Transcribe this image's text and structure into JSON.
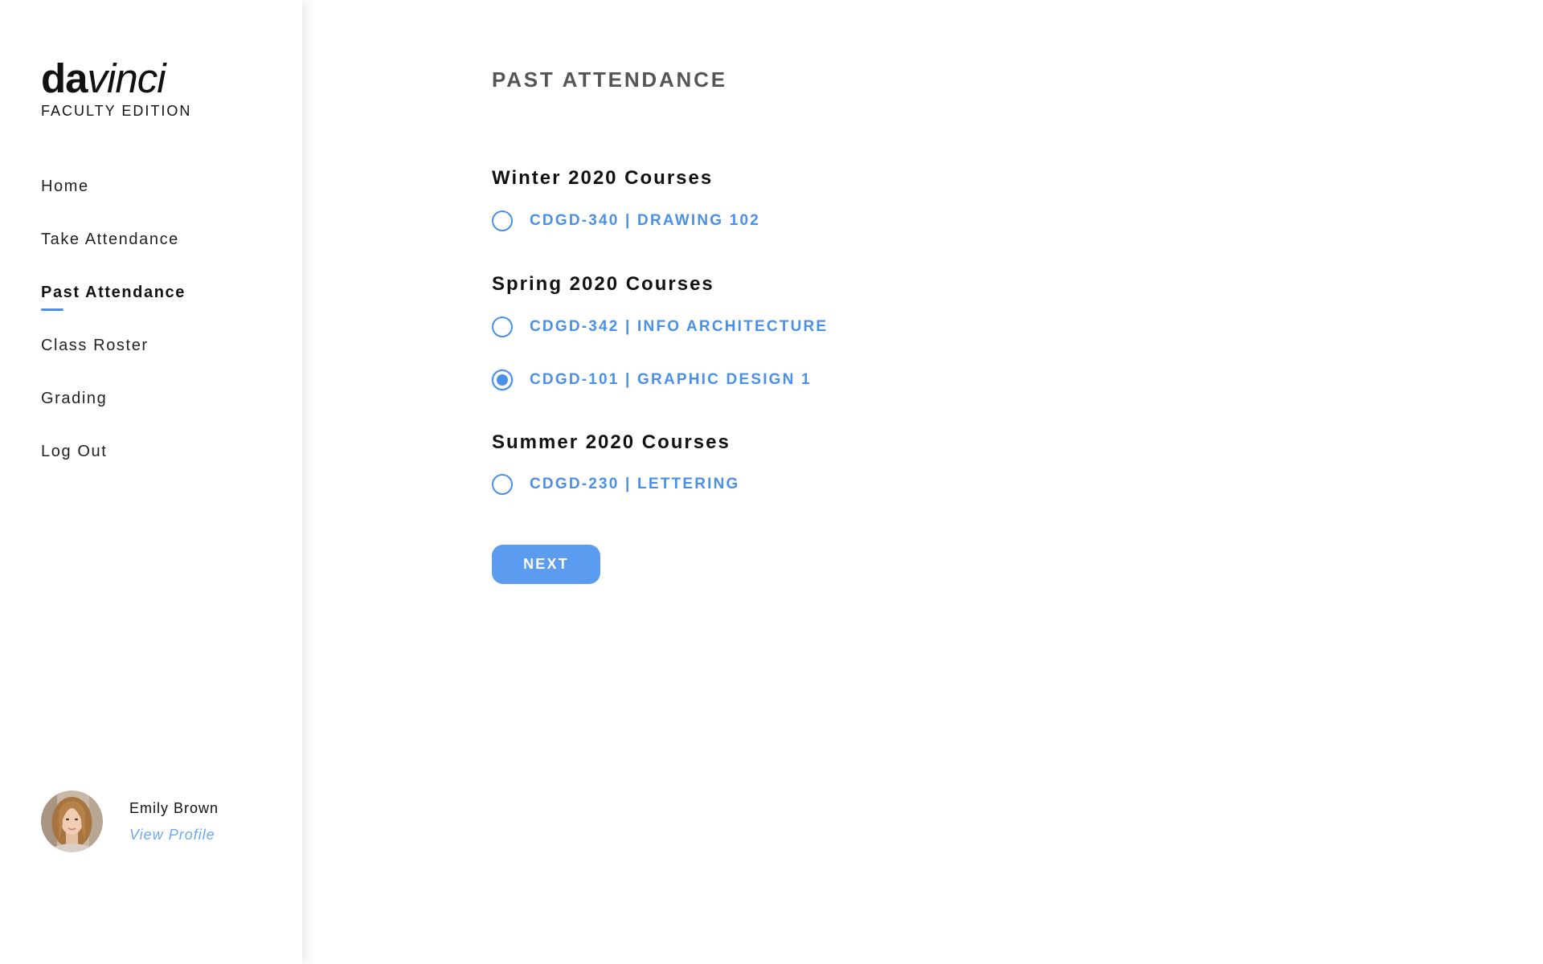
{
  "brand": {
    "name_bold": "da",
    "name_italic": "vinci",
    "edition": "FACULTY EDITION"
  },
  "nav": {
    "items": [
      {
        "label": "Home"
      },
      {
        "label": "Take Attendance"
      },
      {
        "label": "Past Attendance",
        "active": true
      },
      {
        "label": "Class Roster"
      },
      {
        "label": "Grading"
      },
      {
        "label": "Log Out"
      }
    ]
  },
  "profile": {
    "name": "Emily Brown",
    "link_label": "View Profile"
  },
  "main": {
    "title": "PAST ATTENDANCE",
    "terms": [
      {
        "heading": "Winter 2020 Courses",
        "courses": [
          {
            "label": "CDGD-340 | DRAWING 102",
            "selected": false
          }
        ]
      },
      {
        "heading": "Spring 2020 Courses",
        "courses": [
          {
            "label": "CDGD-342 | INFO ARCHITECTURE",
            "selected": false
          },
          {
            "label": "CDGD-101 | GRAPHIC DESIGN 1",
            "selected": true
          }
        ]
      },
      {
        "heading": "Summer 2020 Courses",
        "courses": [
          {
            "label": "CDGD-230 | LETTERING",
            "selected": false
          }
        ]
      }
    ],
    "next_label": "NEXT"
  },
  "colors": {
    "accent": "#4a90e8",
    "button": "#5b9cf0",
    "link": "#6ea8f0"
  },
  "icons": {
    "avatar": "user-avatar-photo",
    "radio": "radio-button-icon"
  }
}
